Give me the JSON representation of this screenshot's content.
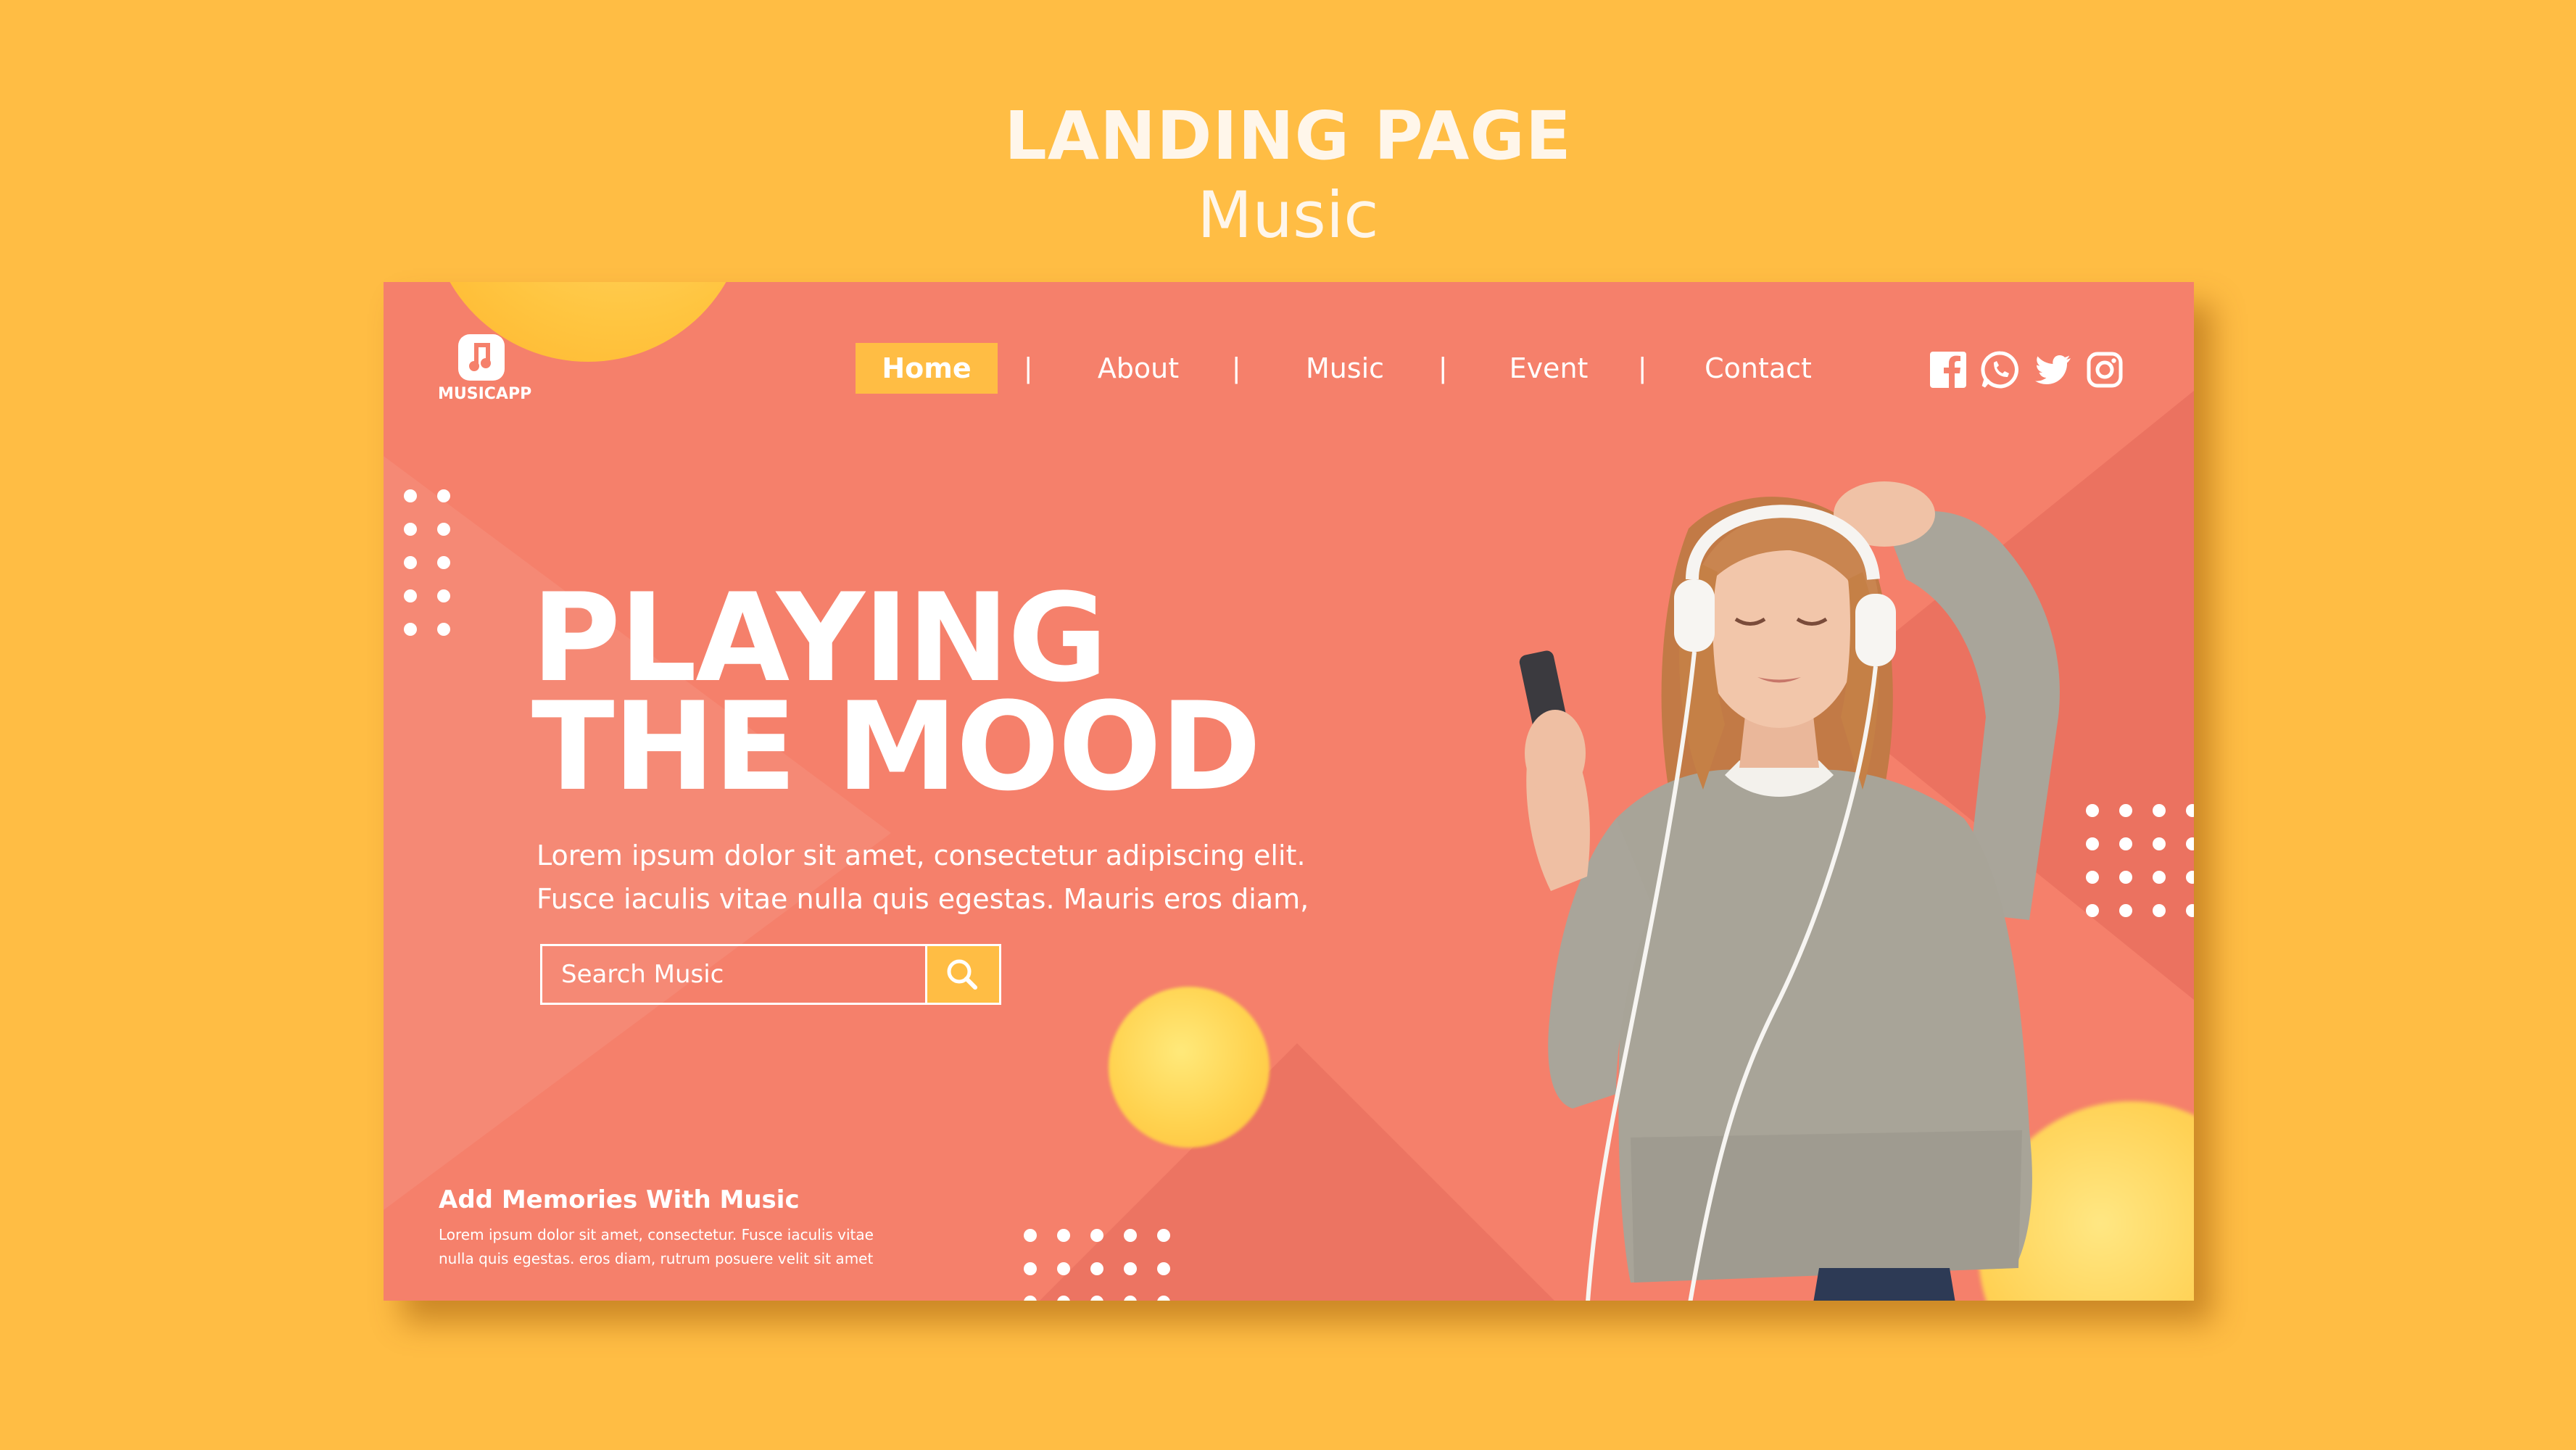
{
  "header": {
    "title": "LANDING PAGE",
    "subtitle": "Music"
  },
  "logo": {
    "icon": "music-note-icon",
    "text": "MUSICAPP"
  },
  "nav": {
    "items": [
      {
        "label": "Home",
        "active": true
      },
      {
        "label": "About",
        "active": false
      },
      {
        "label": "Music",
        "active": false
      },
      {
        "label": "Event",
        "active": false
      },
      {
        "label": "Contact",
        "active": false
      }
    ],
    "separator": "|"
  },
  "social": {
    "icons": [
      "facebook-icon",
      "whatsapp-icon",
      "twitter-icon",
      "instagram-icon"
    ]
  },
  "hero": {
    "title_line1": "PLAYING",
    "title_line2": "THE MOOD",
    "text_line1": "Lorem ipsum dolor sit amet, consectetur adipiscing elit.",
    "text_line2": "Fusce iaculis vitae nulla quis egestas. Mauris eros diam,"
  },
  "search": {
    "placeholder": "Search Music",
    "value": "",
    "button_icon": "search-icon"
  },
  "footer": {
    "title": "Add Memories With Music",
    "text_line1": "Lorem ipsum dolor sit amet, consectetur. Fusce iaculis vitae",
    "text_line2": "nulla quis egestas. eros diam, rutrum posuere velit sit amet"
  },
  "colors": {
    "background": "#ffbd44",
    "card": "#f5806b",
    "accent": "#ffbd44",
    "text": "#ffffff"
  }
}
